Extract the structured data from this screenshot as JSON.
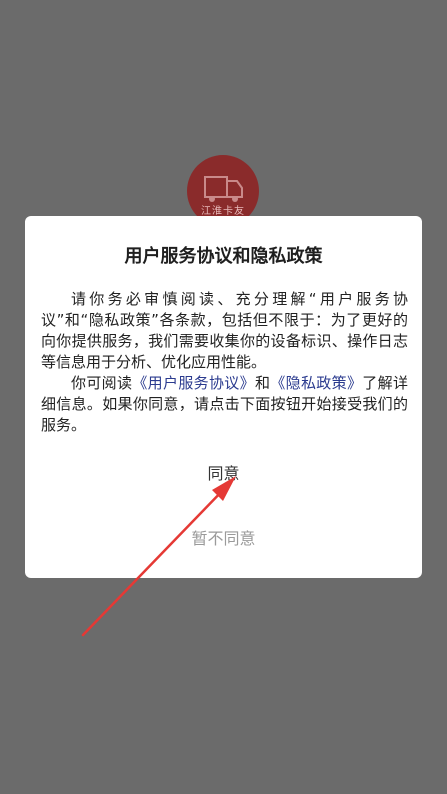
{
  "logo": {
    "text": "江淮卡友",
    "color": "#8a2b2b"
  },
  "dialog": {
    "title": "用户服务协议和隐私政策",
    "paragraph1": "请你务必审慎阅读、充分理解“用户服务协议”和“隐私政策”各条款，包括但不限于：为了更好的向你提供服务，我们需要收集你的设备标识、操作日志等信息用于分析、优化应用性能。",
    "paragraph2_prefix": "你可阅读",
    "link_service": "《用户服务协议》",
    "paragraph2_and": "和",
    "link_privacy": "《隐私政策》",
    "paragraph2_suffix": "了解详细信息。如果你同意，请点击下面按钮开始接受我们的服务。",
    "agree_label": "同意",
    "disagree_label": "暂不同意"
  },
  "colors": {
    "overlay": "#6b6b6b",
    "link": "#2b3b8f",
    "arrow": "#e53935"
  },
  "icons": {
    "arrow": "red-arrow-icon"
  }
}
